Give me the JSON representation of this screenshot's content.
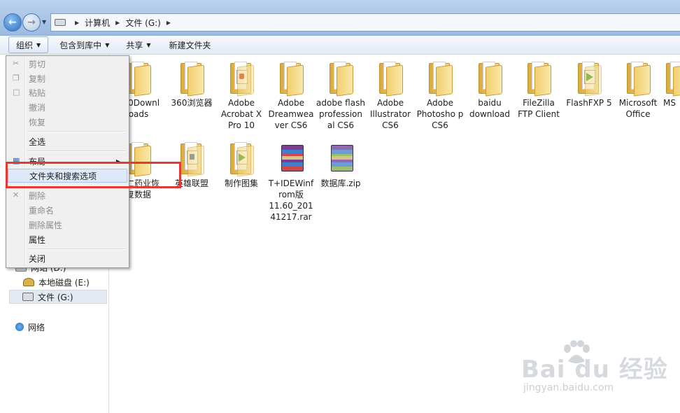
{
  "address": {
    "crumbs": [
      "计算机",
      "文件 (G:)"
    ]
  },
  "toolbar": {
    "organize": "组织",
    "include_in_library": "包含到库中",
    "share": "共享",
    "new_folder": "新建文件夹"
  },
  "nav": {
    "drive_partial": "网站 (D:)",
    "local_disk_e": "本地磁盘 (E:)",
    "drive_g": "文件 (G:)",
    "network": "网络"
  },
  "menu": {
    "cut": "剪切",
    "copy": "复制",
    "paste": "粘贴",
    "undo": "撤消",
    "redo": "恢复",
    "select_all": "全选",
    "layout": "布局",
    "folder_options": "文件夹和搜索选项",
    "delete": "删除",
    "rename": "重命名",
    "remove_properties": "删除属性",
    "properties": "属性",
    "close": "关闭"
  },
  "files": [
    {
      "name": "360Downl oads",
      "kind": "folder"
    },
    {
      "name": "360浏览器",
      "kind": "folder"
    },
    {
      "name": "Adobe Acrobat X Pro 10",
      "kind": "folder-red"
    },
    {
      "name": "Adobe Dreamwea ver CS6",
      "kind": "folder"
    },
    {
      "name": "adobe flash profession al CS6",
      "kind": "folder"
    },
    {
      "name": "Adobe Illustrator CS6",
      "kind": "folder"
    },
    {
      "name": "Adobe Photosho p CS6",
      "kind": "folder"
    },
    {
      "name": "baidu download",
      "kind": "folder"
    },
    {
      "name": "FileZilla FTP Client",
      "kind": "folder"
    },
    {
      "name": "FlashFXP 5",
      "kind": "folder-green"
    },
    {
      "name": "Microsoft Office",
      "kind": "folder"
    },
    {
      "name": "MS",
      "kind": "folder"
    },
    {
      "name": "同仁药业恢复数据",
      "kind": "folder"
    },
    {
      "name": "英雄联盟",
      "kind": "folder"
    },
    {
      "name": "制作图集",
      "kind": "folder-green"
    },
    {
      "name": "T+IDEWinf rom版 11.60_201 41217.rar",
      "kind": "archive"
    },
    {
      "name": "数据库.zip",
      "kind": "archive"
    }
  ],
  "watermark": {
    "logo": "Bai du 经验",
    "url": "jingyan.baidu.com"
  }
}
